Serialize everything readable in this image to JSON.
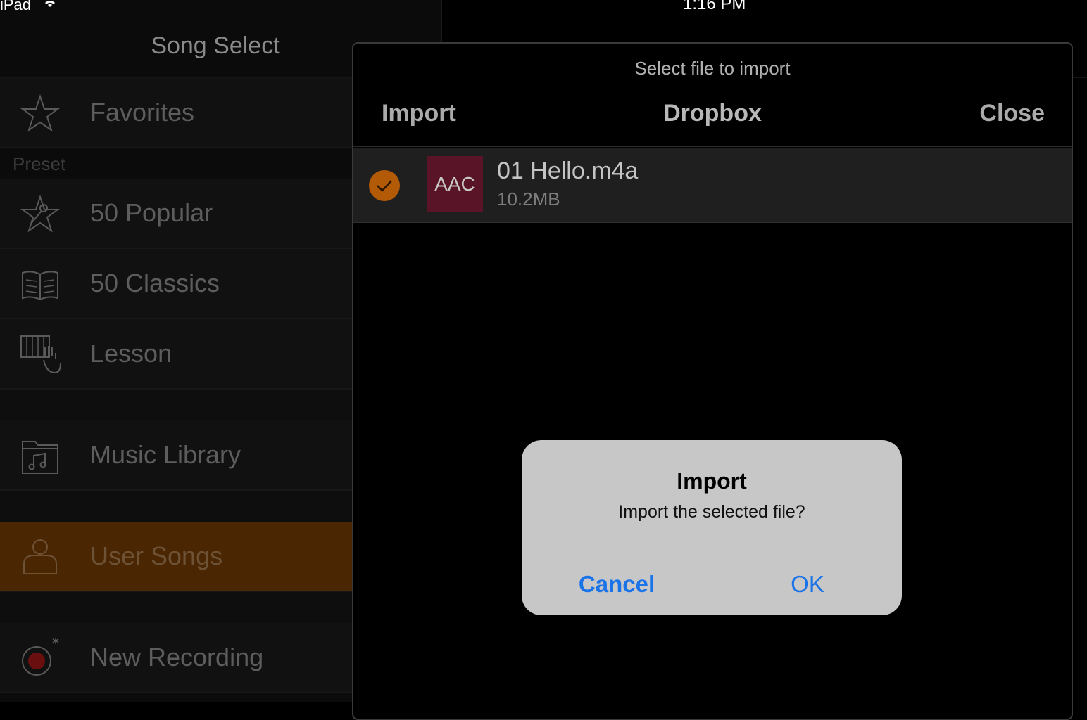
{
  "status": {
    "device": "iPad",
    "time": "1:16 PM"
  },
  "sidebar": {
    "title": "Song Select",
    "favorites": "Favorites",
    "preset_header": "Preset",
    "items": [
      "50 Popular",
      "50 Classics",
      "Lesson"
    ],
    "music_library": "Music Library",
    "user_songs": "User Songs",
    "new_recording": "New Recording"
  },
  "panel": {
    "title": "Select file to import",
    "import_label": "Import",
    "source_label": "Dropbox",
    "close_label": "Close",
    "file": {
      "badge": "AAC",
      "name": "01 Hello.m4a",
      "size": "10.2MB",
      "checked": true
    }
  },
  "alert": {
    "title": "Import",
    "message": "Import the selected file?",
    "cancel_label": "Cancel",
    "ok_label": "OK"
  },
  "colors": {
    "accent_orange": "#b35a06",
    "selected_row": "#4a2602",
    "ios_blue": "#1a73e8",
    "file_badge": "#5a1428"
  }
}
